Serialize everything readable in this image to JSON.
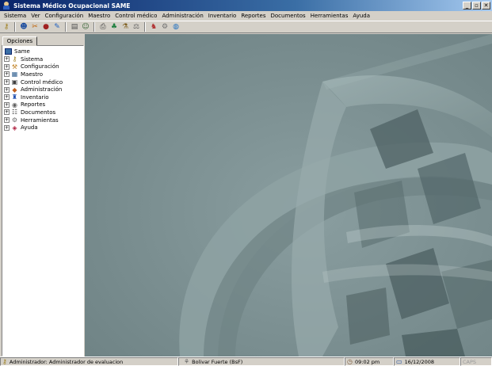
{
  "window": {
    "title": "Sistema Médico Ocupacional SAME",
    "minimize": "_",
    "maximize": "▫",
    "close": "✕"
  },
  "menubar": [
    "Sistema",
    "Ver",
    "Configuración",
    "Maestro",
    "Control médico",
    "Administración",
    "Inventario",
    "Reportes",
    "Documentos",
    "Herramientas",
    "Ayuda"
  ],
  "toolbar": {
    "icons": [
      "key-icon",
      "users-icon",
      "tools-icon",
      "stamp-icon",
      "notebook-icon",
      "report-icon",
      "people-icon",
      "printer-icon",
      "lab-icon",
      "flasks-icon",
      "scale-icon",
      "group-icon",
      "gear-wrench-icon",
      "globe-icon"
    ]
  },
  "sidebar": {
    "tab": "Opciones",
    "root": "Same",
    "items": [
      {
        "label": "Sistema",
        "expander": "+"
      },
      {
        "label": "Configuración",
        "expander": "+"
      },
      {
        "label": "Maestro",
        "expander": "+"
      },
      {
        "label": "Control médico",
        "expander": "+"
      },
      {
        "label": "Administración",
        "expander": "+"
      },
      {
        "label": "Inventario",
        "expander": "+"
      },
      {
        "label": "Reportes",
        "expander": "+"
      },
      {
        "label": "Documentos",
        "expander": "+"
      },
      {
        "label": "Herramientas",
        "expander": "+"
      },
      {
        "label": "Ayuda",
        "expander": "+"
      }
    ]
  },
  "statusbar": {
    "user": "Administrador: Administrador de evaluacion",
    "currency": "Bolivar Fuerte (BsF)",
    "time": "09:02 pm",
    "date": "16/12/2008",
    "caps": "CAPS"
  }
}
